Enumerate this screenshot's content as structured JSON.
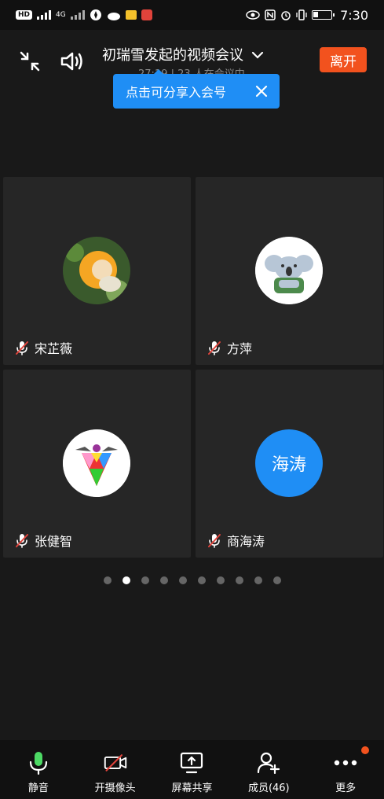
{
  "status_bar": {
    "left_pill": "HD",
    "network": "4G",
    "time": "7:30"
  },
  "header": {
    "title": "初瑞雪发起的视频会议",
    "subtitle": "27:19 | 23 人在会议中",
    "leave_label": "离开",
    "share_tip": "点击可分享入会号"
  },
  "participants": [
    {
      "name": "宋芷薇",
      "avatar_type": "photo",
      "avatar_text": ""
    },
    {
      "name": "方萍",
      "avatar_type": "koala",
      "avatar_text": ""
    },
    {
      "name": "张健智",
      "avatar_type": "logo",
      "avatar_text": ""
    },
    {
      "name": "商海涛",
      "avatar_type": "text",
      "avatar_text": "海涛"
    }
  ],
  "pager": {
    "count": 10,
    "active_index": 1
  },
  "toolbar": {
    "mute_label": "静音",
    "camera_label": "开摄像头",
    "screen_label": "屏幕共享",
    "members_label": "成员(46)",
    "more_label": "更多"
  },
  "colors": {
    "accent_blue": "#1f8ef5",
    "leave_orange": "#f2521e",
    "mic_green": "#4cd964",
    "mute_red": "#e0433b"
  }
}
